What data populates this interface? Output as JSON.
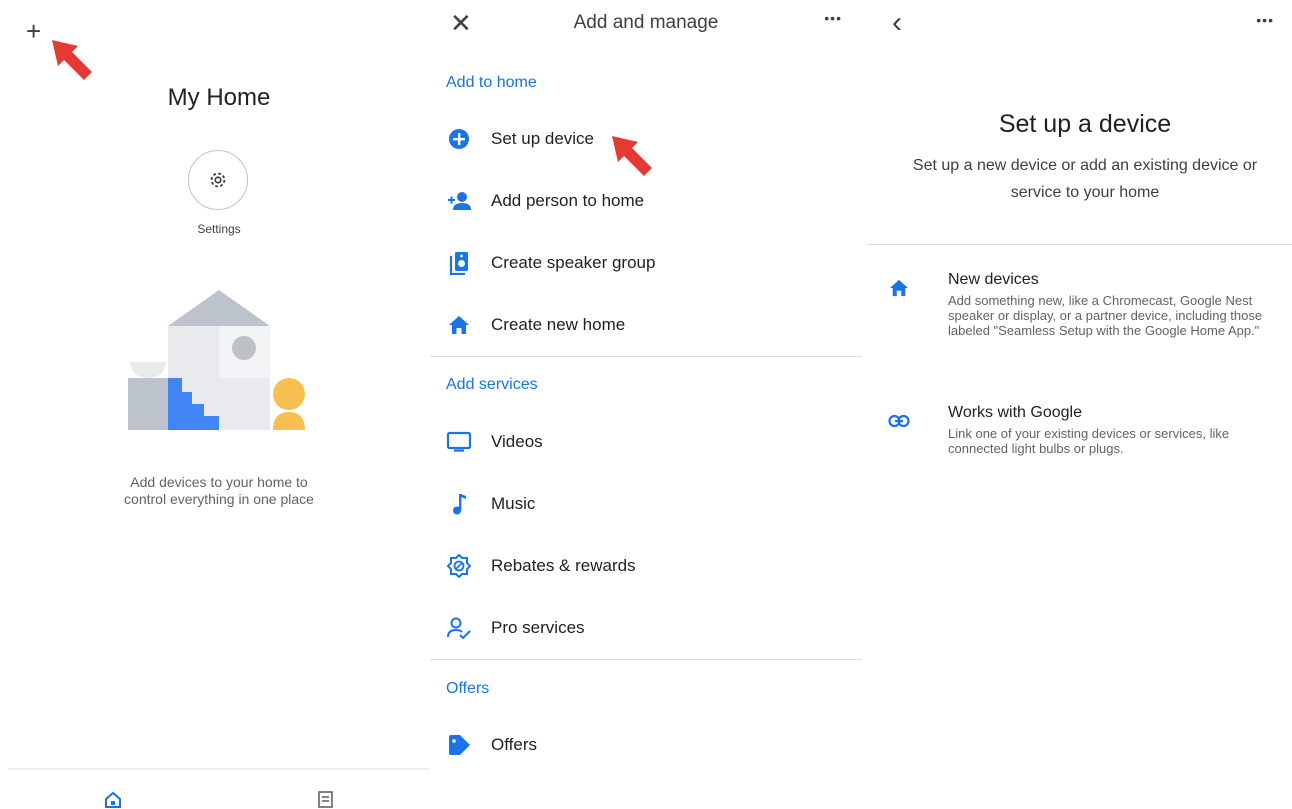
{
  "home_panel": {
    "title": "My Home",
    "settings_label": "Settings",
    "empty_message": "Add devices to your home to control everything in one place"
  },
  "add_manage": {
    "title": "Add and manage",
    "more": "•••",
    "sections": [
      {
        "heading": "Add to home",
        "items": [
          {
            "label": "Set up device",
            "icon": "add-circle-icon"
          },
          {
            "label": "Add person to home",
            "icon": "add-person-icon"
          },
          {
            "label": "Create speaker group",
            "icon": "speaker-group-icon"
          },
          {
            "label": "Create new home",
            "icon": "home-icon"
          }
        ]
      },
      {
        "heading": "Add services",
        "items": [
          {
            "label": "Videos",
            "icon": "tv-icon"
          },
          {
            "label": "Music",
            "icon": "music-note-icon"
          },
          {
            "label": "Rebates & rewards",
            "icon": "rebates-icon"
          },
          {
            "label": "Pro services",
            "icon": "pro-services-icon"
          }
        ]
      },
      {
        "heading": "Offers",
        "items": [
          {
            "label": "Offers",
            "icon": "tag-icon"
          }
        ]
      }
    ]
  },
  "setup": {
    "more": "•••",
    "title": "Set up a device",
    "subtitle": "Set up a new device or add an existing device or service to your home",
    "options": [
      {
        "title": "New devices",
        "description": "Add something new, like a Chromecast, Google Nest speaker or display, or a partner device, including those labeled \"Seamless Setup with the Google Home App.\"",
        "icon": "home-icon"
      },
      {
        "title": "Works with Google",
        "description": "Link one of your existing devices or services, like connected light bulbs or plugs.",
        "icon": "link-icon"
      }
    ]
  },
  "colors": {
    "accent": "#1a73e8",
    "annotation_arrow": "#e53935"
  }
}
